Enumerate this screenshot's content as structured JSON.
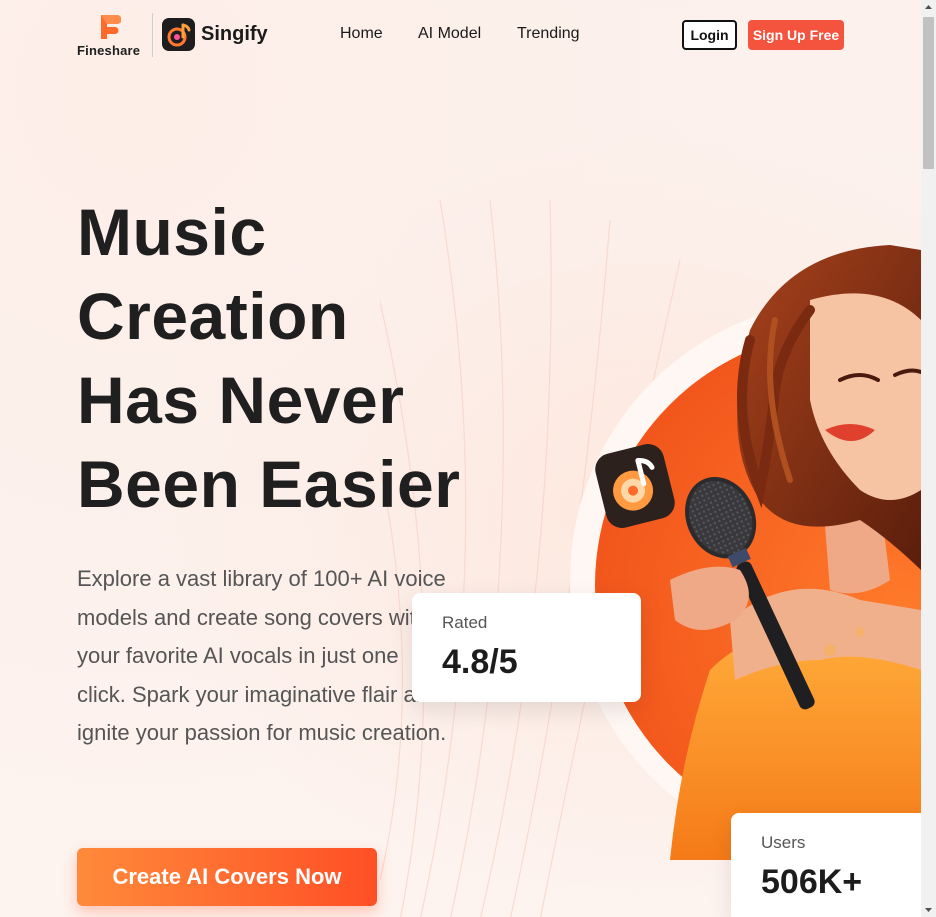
{
  "header": {
    "brand": "Fineshare",
    "product": "Singify",
    "nav": [
      {
        "label": "Home"
      },
      {
        "label": "AI Model"
      },
      {
        "label": "Trending"
      }
    ],
    "login_label": "Login",
    "signup_label": "Sign Up Free"
  },
  "hero": {
    "headline_lines": [
      "Music",
      "Creation",
      "Has Never",
      "Been Easier"
    ],
    "description": "Explore a vast library of 100+ AI voice models and create song covers with your favorite AI vocals in just one click. Spark your imaginative flair and ignite your passion for music creation.",
    "cta_label": "Create AI Covers Now"
  },
  "stats": {
    "rating": {
      "label": "Rated",
      "value": "4.8/5"
    },
    "users": {
      "label": "Users",
      "value": "506K+"
    }
  },
  "colors": {
    "accent": "#f4533d",
    "cta_start": "#ff8a3b",
    "cta_end": "#ff4f25",
    "logo_orange": "#ff6a2b"
  },
  "icons": {
    "fineshare": "fineshare-logo-icon",
    "singify": "singify-app-icon",
    "music_note": "music-note-icon"
  }
}
